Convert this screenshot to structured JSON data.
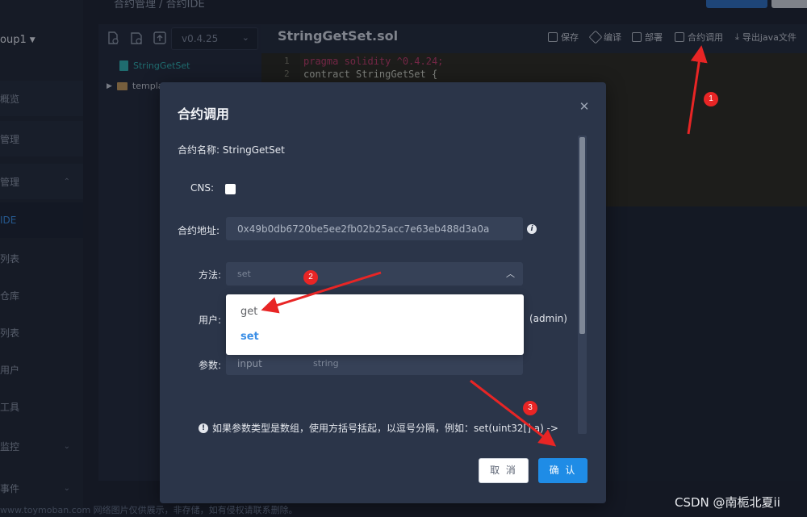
{
  "sidebar": {
    "group": "oup1",
    "items": [
      {
        "label": "概览"
      },
      {
        "label": "管理"
      },
      {
        "label": "管理"
      },
      {
        "label": "IDE"
      },
      {
        "label": "列表"
      },
      {
        "label": "仓库"
      },
      {
        "label": "列表"
      },
      {
        "label": "用户"
      },
      {
        "label": "工具"
      },
      {
        "label": "监控"
      },
      {
        "label": "事件"
      }
    ]
  },
  "topbar": {
    "crumb": "合约管理 / 合约IDE"
  },
  "file_panel": {
    "version": "v0.4.25",
    "files": [
      {
        "name": "StringGetSet"
      },
      {
        "name": "templa"
      }
    ]
  },
  "editor": {
    "file_title": "StringGetSet.sol",
    "toolbar": {
      "save": "保存",
      "compile": "编译",
      "deploy": "部署",
      "call": "合约调用",
      "export": "导出java文件"
    },
    "code": [
      {
        "n": "1",
        "text": "pragma solidity ^0.4.24;"
      },
      {
        "n": "2",
        "text": "contract StringGetSet {"
      }
    ]
  },
  "dialog": {
    "title": "合约调用",
    "contract_name_label": "合约名称:",
    "contract_name": "StringGetSet",
    "cns_label": "CNS:",
    "address_label": "合约地址:",
    "address": "0x49b0db6720be5ee2fb02b25acc7e63eb488d3a0a",
    "method_label": "方法:",
    "method_value": "set",
    "user_label": "用户:",
    "user_suffix": "(admin)",
    "param_label": "参数:",
    "param_placeholder": "input",
    "param_type": "string",
    "tip": "如果参数类型是数组，使用方括号括起，以逗号分隔，例如：set(uint32[] a) ->",
    "cancel": "取 消",
    "confirm": "确 认"
  },
  "dropdown": {
    "options": [
      "get",
      "set"
    ],
    "selected": "set"
  },
  "annotations": [
    "1",
    "2",
    "3"
  ],
  "watermark": "CSDN @南栀北夏ii",
  "footer": "www.toymoban.com 网络图片仅供展示，非存储，如有侵权请联系删除。",
  "colors": {
    "accent": "#1f8ce6",
    "annotation": "#e82525"
  }
}
